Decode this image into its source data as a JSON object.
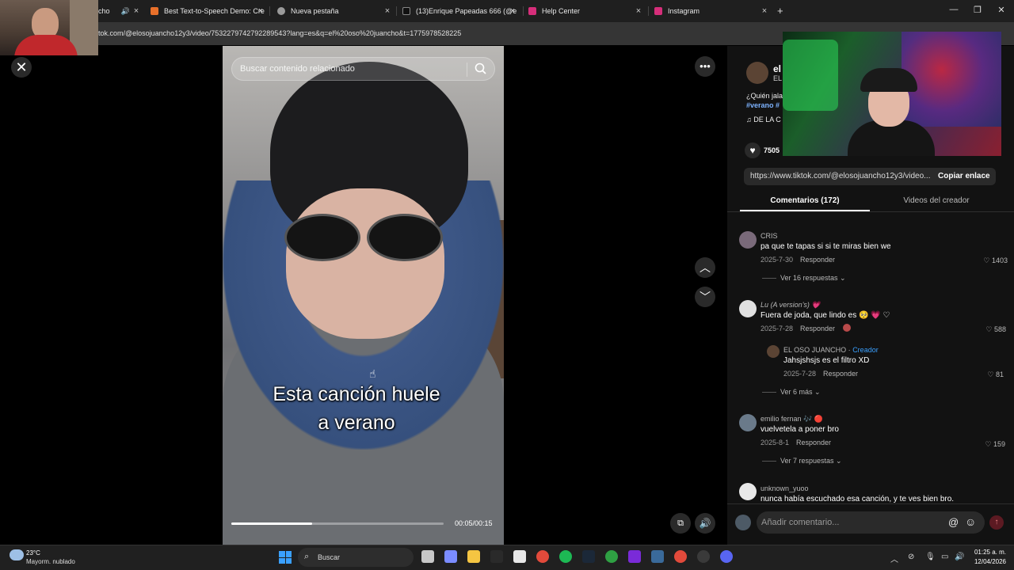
{
  "browser": {
    "tabs": [
      {
        "title": "cho",
        "favicon_color": "#444444"
      },
      {
        "title": "Best Text-to-Speech Demo: Cre",
        "favicon_color": "#e8702a"
      },
      {
        "title": "Nueva pestaña",
        "favicon_color": "#9a9a9a"
      },
      {
        "title": "(13)Enrique Papeadas 666 (@e",
        "favicon_color": "#111111"
      },
      {
        "title": "Help Center",
        "favicon_color": "#d62e7a"
      },
      {
        "title": "Instagram",
        "favicon_color": "#d62e7a"
      }
    ],
    "url": "tok.com/@elosojuancho12y3/video/7532279742792289543?lang=es&q=el%20oso%20juancho&t=1775978528225",
    "new_tab": "+",
    "close_glyph": "×"
  },
  "video": {
    "search_placeholder": "Buscar contenido relacionado",
    "caption_line1": "Esta canción huele",
    "caption_line2": "a verano",
    "time": "00:05/00:15",
    "progress": 0.38
  },
  "author": {
    "name": "el",
    "sub": "EL",
    "description": "¿Quién jala",
    "hashtags": "#verano #",
    "music": "♫  DE LA C",
    "likes": "7505"
  },
  "share": {
    "link": "https://www.tiktok.com/@elosojuancho12y3/video...",
    "copy_label": "Copiar enlace"
  },
  "panel_tabs": {
    "comments": "Comentarios (172)",
    "creator_videos": "Videos del creador"
  },
  "comments": [
    {
      "user": "CRIS",
      "text": "pa que te tapas si si te miras bien we",
      "date": "2025-7-30",
      "reply": "Responder",
      "likes": "1403",
      "more": "Ver 16 respuestas",
      "avatar_color": "#7a6a7a"
    },
    {
      "user": "Lu (A version's) 💗",
      "text": "Fuera de joda, que lindo es 🥺 💗 ♡",
      "date": "2025-7-28",
      "reply": "Responder",
      "likes": "588",
      "avatar_color": "#e0e0e0"
    },
    {
      "user": "EL OSO JUANCHO · ",
      "creator": "Creador",
      "text": "Jahsjshsjs es el filtro XD",
      "date": "2025-7-28",
      "reply": "Responder",
      "likes": "81",
      "more": "Ver 6 más",
      "avatar_color": "#5b4434"
    },
    {
      "user": "emilio fernan 🎶 🔴",
      "text": "vuelvetela a poner bro",
      "date": "2025-8-1",
      "reply": "Responder",
      "likes": "159",
      "more": "Ver 7 respuestas",
      "avatar_color": "#6a7a8a"
    },
    {
      "user": "unknown_yuoo",
      "text": "nunca había escuchado esa canción, y te ves bien bro.",
      "avatar_color": "#e8e8e8"
    }
  ],
  "comment_input": {
    "placeholder": "Añadir comentario...",
    "at": "@",
    "emoji": "☺",
    "send": "↑"
  },
  "taskbar": {
    "temperature": "23°C",
    "weather": "Mayorm. nublado",
    "search": "Buscar",
    "time": "01:25 a. m.",
    "date": "12/04/2026",
    "icons": [
      {
        "name": "task-view-icon",
        "color": "#c8c8c8"
      },
      {
        "name": "copilot-icon",
        "color": "#7b8cff"
      },
      {
        "name": "file-explorer-icon",
        "color": "#f5c542"
      },
      {
        "name": "epic-games-icon",
        "color": "#2a2a2a"
      },
      {
        "name": "store-icon",
        "color": "#e8e8e8"
      },
      {
        "name": "chrome-icon",
        "color": "#e24a3b"
      },
      {
        "name": "spotify-icon",
        "color": "#1db954"
      },
      {
        "name": "steam-icon",
        "color": "#1b2838"
      },
      {
        "name": "xbox-icon",
        "color": "#2fa043"
      },
      {
        "name": "next-app-icon",
        "color": "#7a2bd8"
      },
      {
        "name": "steam-alt-icon",
        "color": "#3a6a9a"
      },
      {
        "name": "chrome-active-icon",
        "color": "#e24a3b"
      },
      {
        "name": "obs-icon",
        "color": "#3a3a3a"
      },
      {
        "name": "discord-icon",
        "color": "#5865f2"
      }
    ]
  },
  "colors": {
    "accent_link": "#3aa0ff",
    "panel_bg": "#121212",
    "taskbar_bg": "#202020"
  }
}
